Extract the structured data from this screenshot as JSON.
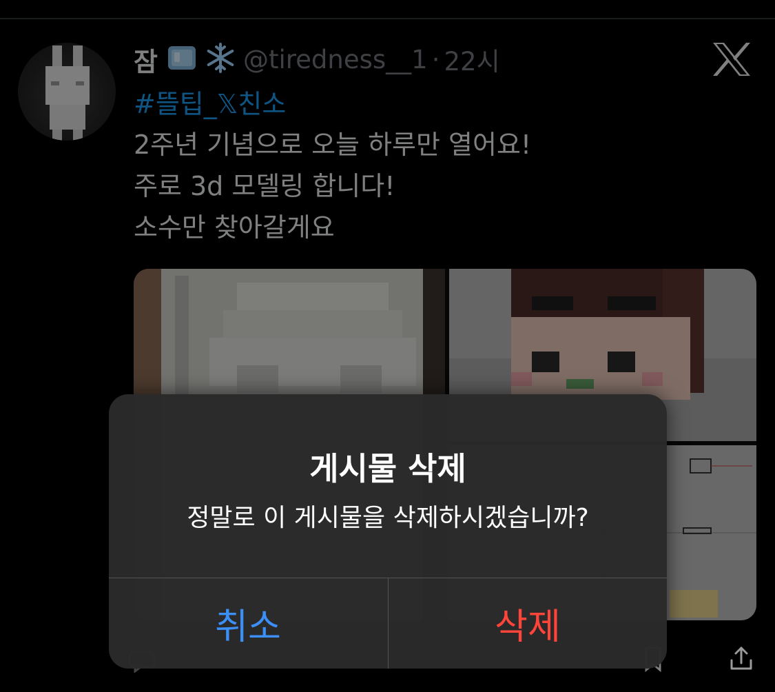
{
  "tweet": {
    "display_name": "잠",
    "handle": "@tiredness__1",
    "separator": "·",
    "time": "22시",
    "hashtag": "#뜰팁_𝕏친소",
    "lines": [
      "2주년 기념으로 오늘 하루만 열어요!",
      "주로 3d 모델링 합니다!",
      "소수만 찾아갈게요"
    ]
  },
  "icons": {
    "emoji_1": "ice-cube-icon",
    "emoji_2": "snowflake-icon",
    "logo": "x-logo-icon",
    "share": "share-icon",
    "reply": "reply-icon",
    "bookmark": "bookmark-icon"
  },
  "dialog": {
    "title": "게시물 삭제",
    "message": "정말로 이 게시물을 삭제하시겠습니까?",
    "cancel_label": "취소",
    "delete_label": "삭제"
  },
  "colors": {
    "background": "#000000",
    "link": "#1d9bf0",
    "cancel": "#3b8ff7",
    "destructive": "#ff453a",
    "dialog": "#2a2a2a"
  }
}
